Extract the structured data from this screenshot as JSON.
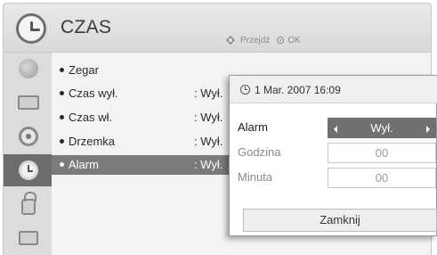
{
  "header": {
    "title": "CZAS",
    "nav_hint_move": "Przejdź",
    "nav_hint_ok": "OK"
  },
  "sidebar": {
    "items": [
      {
        "name": "satellite-icon",
        "active": false
      },
      {
        "name": "tv-icon",
        "active": false
      },
      {
        "name": "speaker-icon",
        "active": false
      },
      {
        "name": "clock-icon",
        "active": true
      },
      {
        "name": "lock-icon",
        "active": false
      },
      {
        "name": "options-icon",
        "active": false
      }
    ]
  },
  "menu": {
    "items": [
      {
        "label": "Zegar",
        "value": ""
      },
      {
        "label": "Czas wył.",
        "value": ": Wył."
      },
      {
        "label": "Czas wł.",
        "value": ": Wył."
      },
      {
        "label": "Drzemka",
        "value": ": Wył."
      },
      {
        "label": "Alarm",
        "value": ": Wył."
      }
    ],
    "selected_index": 4
  },
  "popup": {
    "datetime": "1 Mar. 2007 16:09",
    "rows": [
      {
        "label": "Alarm",
        "value": "Wył.",
        "active": true
      },
      {
        "label": "Godzina",
        "value": "00",
        "active": false
      },
      {
        "label": "Minuta",
        "value": "00",
        "active": false
      }
    ],
    "close_label": "Zamknij"
  }
}
